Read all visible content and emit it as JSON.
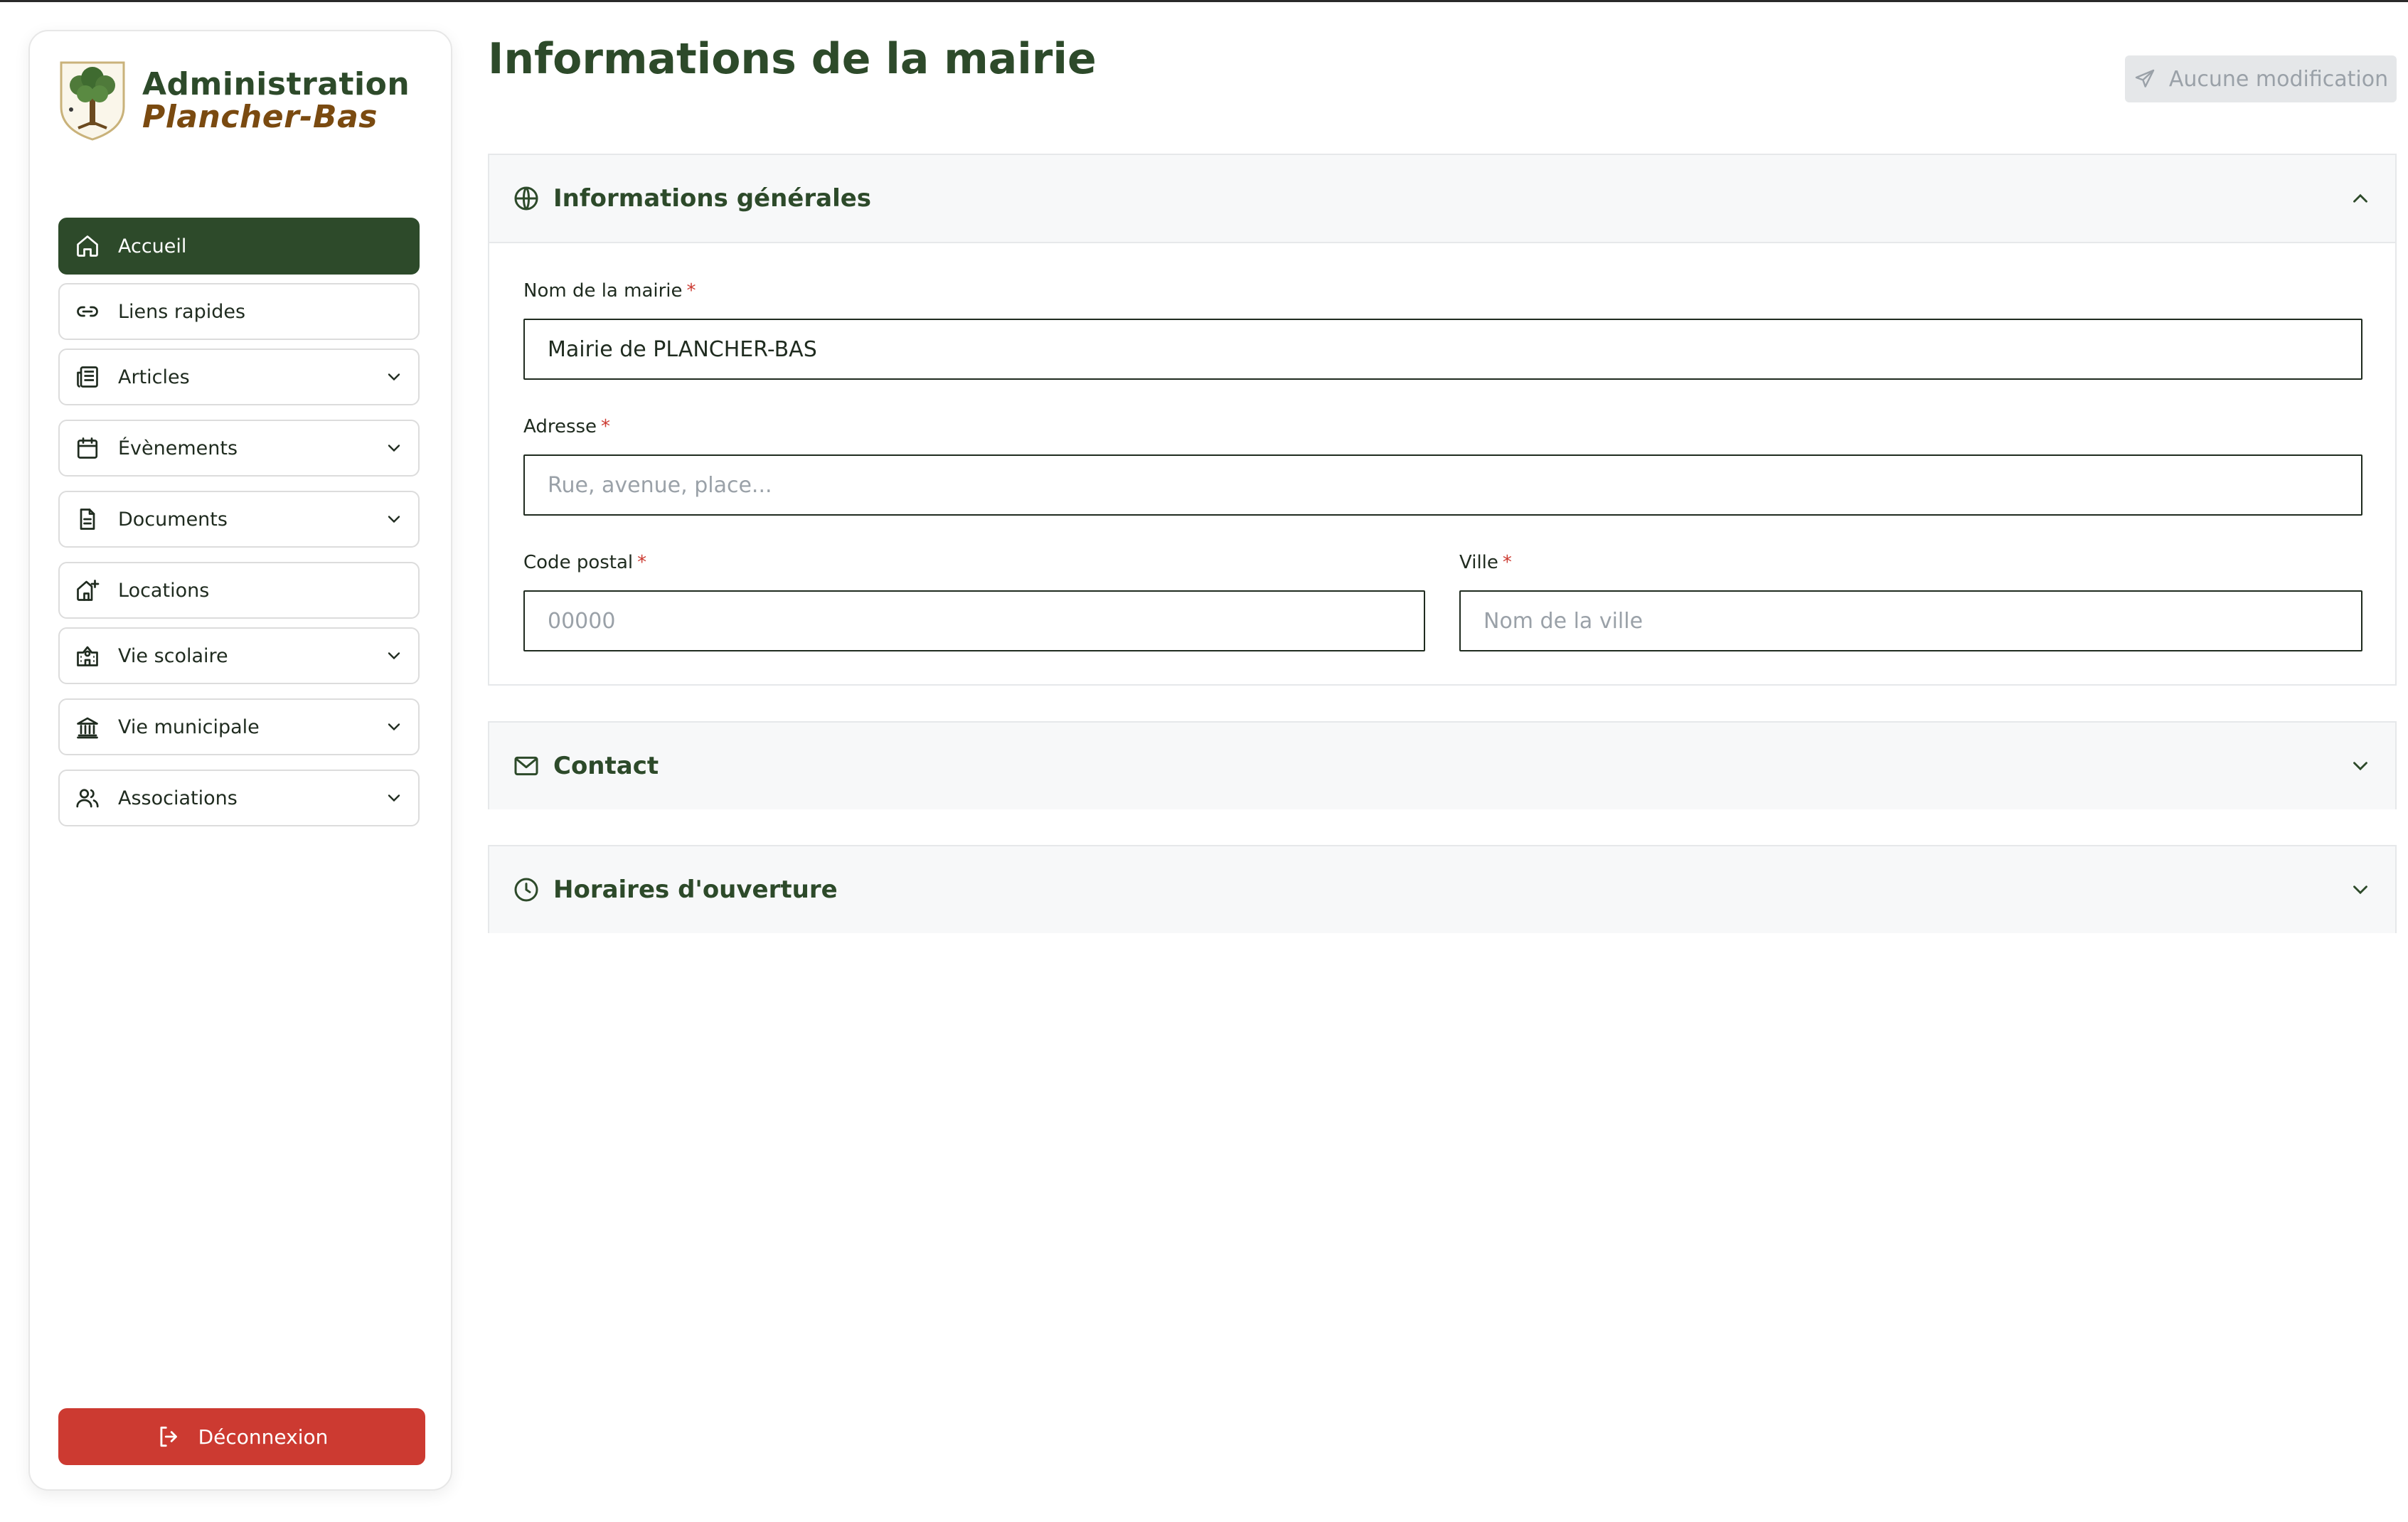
{
  "sidebar": {
    "brand": {
      "line1": "Administration",
      "line2": "Plancher-Bas"
    },
    "items": [
      {
        "label": "Accueil",
        "icon": "home-icon",
        "has_chevron": false,
        "active": true
      },
      {
        "label": "Liens rapides",
        "icon": "link-icon",
        "has_chevron": false
      },
      {
        "label": "Articles",
        "icon": "newspaper-icon",
        "has_chevron": true
      },
      {
        "label": "Évènements",
        "icon": "calendar-icon",
        "has_chevron": true
      },
      {
        "label": "Documents",
        "icon": "document-icon",
        "has_chevron": true
      },
      {
        "label": "Locations",
        "icon": "house-plus-icon",
        "has_chevron": false
      },
      {
        "label": "Vie scolaire",
        "icon": "school-icon",
        "has_chevron": true
      },
      {
        "label": "Vie municipale",
        "icon": "town-hall-icon",
        "has_chevron": true
      },
      {
        "label": "Associations",
        "icon": "users-icon",
        "has_chevron": true
      }
    ],
    "logout_label": "Déconnexion"
  },
  "main": {
    "title": "Informations de la mairie",
    "save_button": {
      "label": "Aucune modification",
      "icon": "send-icon",
      "disabled": true
    },
    "sections": {
      "general": {
        "title": "Informations générales",
        "icon": "globe-icon",
        "expanded": true,
        "fields": {
          "name": {
            "label": "Nom de la mairie",
            "required": "*",
            "value": "Mairie de PLANCHER-BAS",
            "placeholder": ""
          },
          "address": {
            "label": "Adresse",
            "required": "*",
            "value": "",
            "placeholder": "Rue, avenue, place..."
          },
          "postal": {
            "label": "Code postal",
            "required": "*",
            "value": "",
            "placeholder": "00000"
          },
          "city": {
            "label": "Ville",
            "required": "*",
            "value": "",
            "placeholder": "Nom de la ville"
          }
        }
      },
      "contact": {
        "title": "Contact",
        "icon": "mail-icon",
        "expanded": false
      },
      "hours": {
        "title": "Horaires d'ouverture",
        "icon": "clock-icon",
        "expanded": false
      }
    }
  },
  "colors": {
    "primary_green": "#2d4a2a",
    "brand_brown": "#7a4a10",
    "danger_red": "#cc3a31",
    "disabled_gray": "#e5e7e9"
  }
}
